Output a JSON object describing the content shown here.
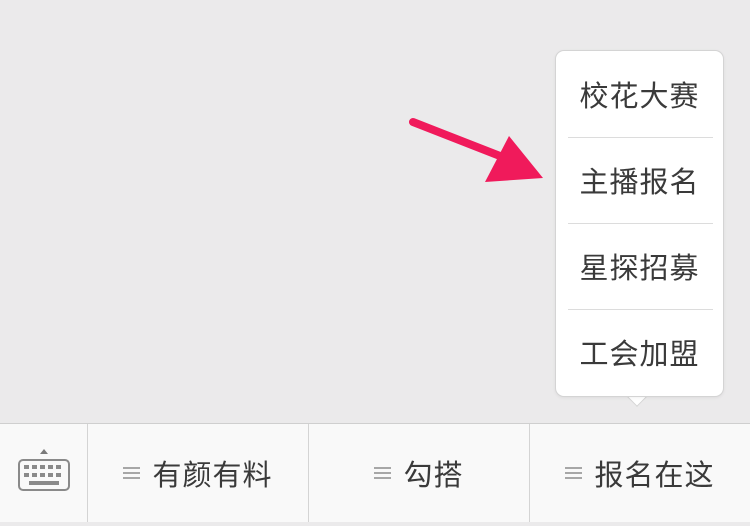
{
  "submenu": {
    "items": [
      {
        "label": "校花大赛"
      },
      {
        "label": "主播报名"
      },
      {
        "label": "星探招募"
      },
      {
        "label": "工会加盟"
      }
    ]
  },
  "menubar": {
    "keyboard_toggle_icon": "keyboard-icon",
    "tabs": [
      {
        "label": "有颜有料",
        "icon": "menu-lines-icon"
      },
      {
        "label": "勾搭",
        "icon": "menu-lines-icon"
      },
      {
        "label": "报名在这",
        "icon": "menu-lines-icon"
      }
    ]
  },
  "colors": {
    "background": "#ebeaeb",
    "annotation_arrow": "#f01a5b",
    "text": "#3a3a3a"
  }
}
